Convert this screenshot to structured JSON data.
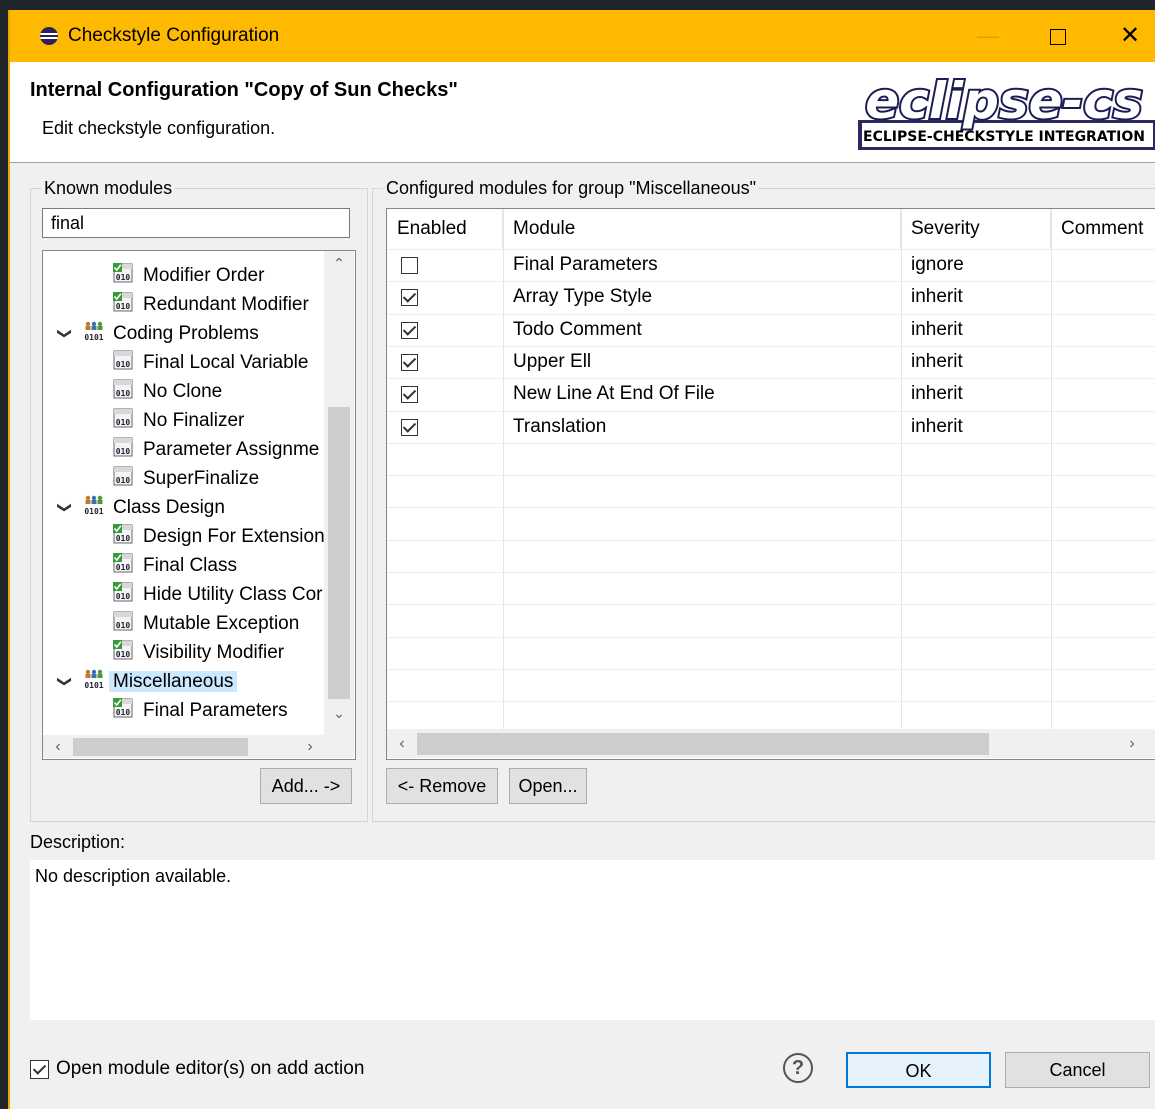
{
  "window": {
    "title": "Checkstyle Configuration",
    "min_icon": "minimize-icon",
    "max_icon": "maximize-icon",
    "close_icon": "close-icon"
  },
  "header": {
    "title": "Internal Configuration \"Copy of Sun Checks\"",
    "subtitle": "Edit checkstyle configuration.",
    "logo_main": "eclipse-cs",
    "logo_sub": "ECLIPSE-CHECKSTYLE INTEGRATION"
  },
  "known": {
    "legend": "Known modules",
    "search_value": "final",
    "tree": [
      {
        "label": "Modifier Order",
        "level": 2,
        "type": "module-configured"
      },
      {
        "label": "Redundant Modifier",
        "level": 2,
        "type": "module-configured"
      },
      {
        "label": "Coding Problems",
        "level": 1,
        "type": "group",
        "expanded": true
      },
      {
        "label": "Final Local Variable",
        "level": 2,
        "type": "module"
      },
      {
        "label": "No Clone",
        "level": 2,
        "type": "module"
      },
      {
        "label": "No Finalizer",
        "level": 2,
        "type": "module"
      },
      {
        "label": "Parameter Assignme",
        "level": 2,
        "type": "module"
      },
      {
        "label": "SuperFinalize",
        "level": 2,
        "type": "module"
      },
      {
        "label": "Class Design",
        "level": 1,
        "type": "group",
        "expanded": true
      },
      {
        "label": "Design For Extension",
        "level": 2,
        "type": "module-configured"
      },
      {
        "label": "Final Class",
        "level": 2,
        "type": "module-configured"
      },
      {
        "label": "Hide Utility Class Cor",
        "level": 2,
        "type": "module-configured"
      },
      {
        "label": "Mutable Exception",
        "level": 2,
        "type": "module"
      },
      {
        "label": "Visibility Modifier",
        "level": 2,
        "type": "module-configured"
      },
      {
        "label": "Miscellaneous",
        "level": 1,
        "type": "group",
        "expanded": true,
        "selected": true
      },
      {
        "label": "Final Parameters",
        "level": 2,
        "type": "module-configured"
      }
    ],
    "add_button": "Add... ->"
  },
  "configured": {
    "legend": "Configured modules for group \"Miscellaneous\"",
    "columns": [
      "Enabled",
      "Module",
      "Severity",
      "Comment"
    ],
    "rows": [
      {
        "enabled": false,
        "module": "Final Parameters",
        "severity": "ignore",
        "comment": ""
      },
      {
        "enabled": true,
        "module": "Array Type Style",
        "severity": "inherit",
        "comment": ""
      },
      {
        "enabled": true,
        "module": "Todo Comment",
        "severity": "inherit",
        "comment": ""
      },
      {
        "enabled": true,
        "module": "Upper Ell",
        "severity": "inherit",
        "comment": ""
      },
      {
        "enabled": true,
        "module": "New Line At End Of File",
        "severity": "inherit",
        "comment": ""
      },
      {
        "enabled": true,
        "module": "Translation",
        "severity": "inherit",
        "comment": ""
      }
    ],
    "remove_button": "<- Remove",
    "open_button": "Open..."
  },
  "description": {
    "label": "Description:",
    "text": "No description available."
  },
  "footer": {
    "open_editor_checked": true,
    "open_editor_label": "Open module editor(s) on add action",
    "help_glyph": "?",
    "ok": "OK",
    "cancel": "Cancel"
  },
  "colors": {
    "titlebar": "#ffb900",
    "selection": "#cce8ff",
    "ok_border": "#0078d7"
  }
}
